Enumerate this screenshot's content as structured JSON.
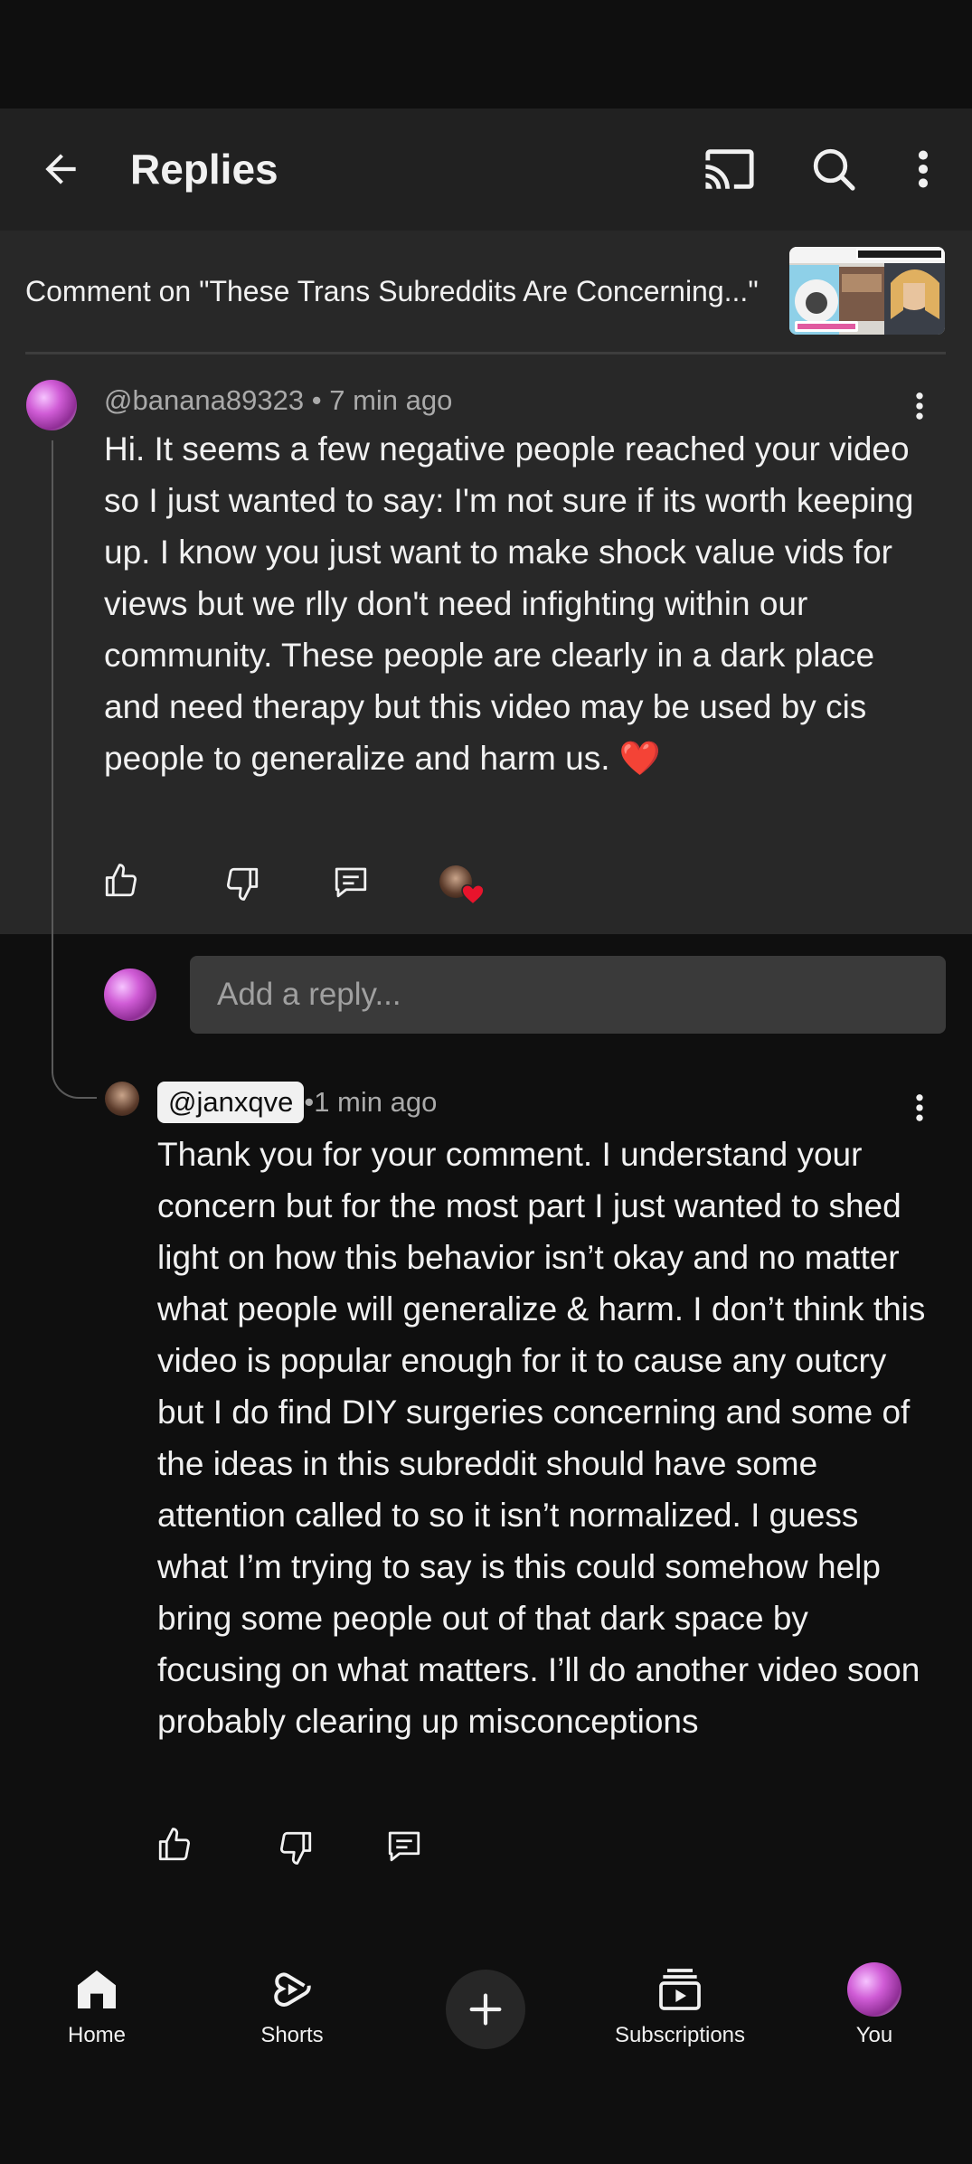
{
  "app_bar": {
    "title": "Replies"
  },
  "context": {
    "text": "Comment on \"These Trans Subreddits Are Concerning...\""
  },
  "parent_comment": {
    "author": "@banana89323",
    "separator": " • ",
    "time": "7 min ago",
    "text": "Hi. It seems a few negative people reached your video so I just wanted to say: I'm not sure if its worth keeping up. I know you just want to make shock value vids for views but we rlly don't need infighting within our community. These people are clearly in a dark place and need therapy but this video may be used by cis people to generalize and harm us. ❤️"
  },
  "reply_input": {
    "placeholder": "Add a reply..."
  },
  "reply_comment": {
    "author": "@janxqve",
    "separator": " • ",
    "time": "1 min ago",
    "text": "Thank you for your comment. I understand your concern but for the most part I just wanted to shed light on how this behavior isn’t okay and no matter what people will generalize & harm. I don’t think this video is popular enough for it to cause any outcry but I do find DIY surgeries concerning and some of the ideas in this subreddit should have some attention called to so it isn’t normalized. I guess what I’m trying to say is this could somehow help bring some people out of that dark space by focusing on what matters. I’ll do another video soon probably clearing up misconceptions"
  },
  "bottom_nav": {
    "home": "Home",
    "shorts": "Shorts",
    "subscriptions": "Subscriptions",
    "you": "You"
  },
  "colors": {
    "background": "#0f0f0f",
    "surface": "#212121",
    "highlight": "#282828",
    "heart": "#e8142c"
  }
}
